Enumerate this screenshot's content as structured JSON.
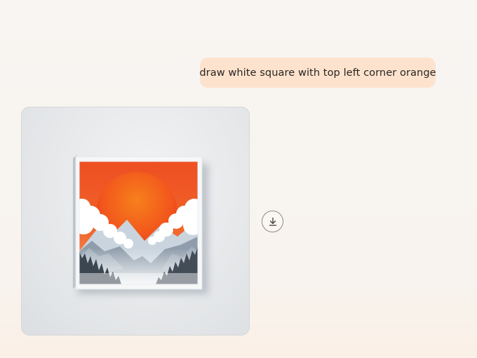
{
  "conversation": {
    "user_message": {
      "text": "draw white square with top left corner orange"
    },
    "assistant_response": {
      "image": {
        "subject": "white-framed square picture with an orange sky, large red-orange sun, clouds, mountains and dark pine forest"
      },
      "download_icon": "download-icon"
    }
  },
  "colors": {
    "user_bubble_bg": "#fde3ce",
    "page_bg": "#f8f5f2",
    "sky_orange": "#ef5a24",
    "sun_orange": "#f26a1b"
  }
}
